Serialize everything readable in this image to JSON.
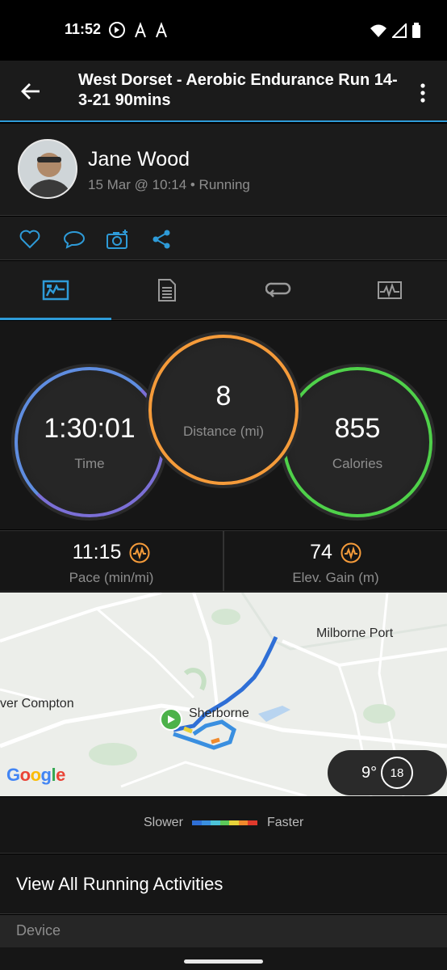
{
  "status_bar": {
    "time": "11:52",
    "left_icons": [
      "do-not-disturb-icon",
      "strava-icon",
      "strava-icon"
    ],
    "right_icons": [
      "wifi-icon",
      "signal-icon",
      "battery-icon"
    ]
  },
  "app_bar": {
    "title": "West Dorset - Aerobic Endurance Run 14-3-21 90mins"
  },
  "profile": {
    "name": "Jane Wood",
    "meta": "15 Mar @ 10:14 • Running"
  },
  "actions": [
    "like-icon",
    "comment-icon",
    "add-photo-icon",
    "share-icon"
  ],
  "tabs": [
    {
      "icon": "stats-icon",
      "active": true
    },
    {
      "icon": "details-icon",
      "active": false
    },
    {
      "icon": "laps-icon",
      "active": false
    },
    {
      "icon": "charts-icon",
      "active": false
    }
  ],
  "stats": {
    "time": {
      "value": "1:30:01",
      "label": "Time",
      "color": "#7b6fd6"
    },
    "distance": {
      "value": "8",
      "label": "Distance (mi)",
      "color": "#f59b3a"
    },
    "calories": {
      "value": "855",
      "label": "Calories",
      "color": "#4fd14a"
    }
  },
  "metrics": {
    "pace": {
      "value": "11:15",
      "label": "Pace (min/mi)"
    },
    "elev": {
      "value": "74",
      "label": "Elev. Gain (m)"
    }
  },
  "map": {
    "labels": {
      "milborne": "Milborne Port",
      "compton": "ver Compton",
      "sherborne": "Sherborne"
    },
    "attribution": "Google",
    "temperature": "9°",
    "wind": "18"
  },
  "legend": {
    "slower": "Slower",
    "faster": "Faster",
    "colors": [
      "#2f6fd6",
      "#3a8fe0",
      "#4cc3d9",
      "#5cc95a",
      "#e6d23a",
      "#f08a2c",
      "#e03a2c"
    ]
  },
  "view_all": "View All Running Activities",
  "section": "Device",
  "colors": {
    "accent": "#2e9bd8",
    "orange": "#f59b3a"
  }
}
